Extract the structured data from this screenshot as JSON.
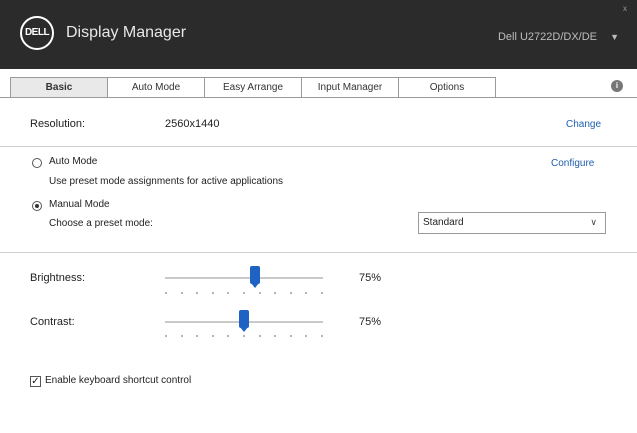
{
  "window": {
    "logo_text": "DELL",
    "title": "Display Manager",
    "monitor": "Dell U2722D/DX/DE",
    "monitor_caret": "▼",
    "close": "x"
  },
  "tabs": [
    {
      "label": "Basic",
      "active": true
    },
    {
      "label": "Auto Mode",
      "active": false
    },
    {
      "label": "Easy Arrange",
      "active": false
    },
    {
      "label": "Input Manager",
      "active": false
    },
    {
      "label": "Options",
      "active": false
    }
  ],
  "info_icon": "i",
  "resolution": {
    "label": "Resolution:",
    "value": "2560x1440",
    "change_link": "Change"
  },
  "auto_mode": {
    "label": "Auto Mode",
    "description": "Use preset mode assignments for active applications",
    "configure_link": "Configure",
    "selected": false
  },
  "manual_mode": {
    "label": "Manual Mode",
    "description": "Choose a preset mode:",
    "selected": true,
    "preset_value": "Standard",
    "preset_caret": "∨"
  },
  "brightness": {
    "label": "Brightness:",
    "value_text": "75%",
    "value": 75
  },
  "contrast": {
    "label": "Contrast:",
    "value_text": "75%",
    "value": 75
  },
  "keyboard_control": {
    "label": "Enable keyboard shortcut control",
    "checked": true,
    "check_glyph": "✓"
  },
  "colors": {
    "titlebar": "#2b2b2b",
    "accent": "#1e63c4",
    "link": "#1f5fb0"
  }
}
